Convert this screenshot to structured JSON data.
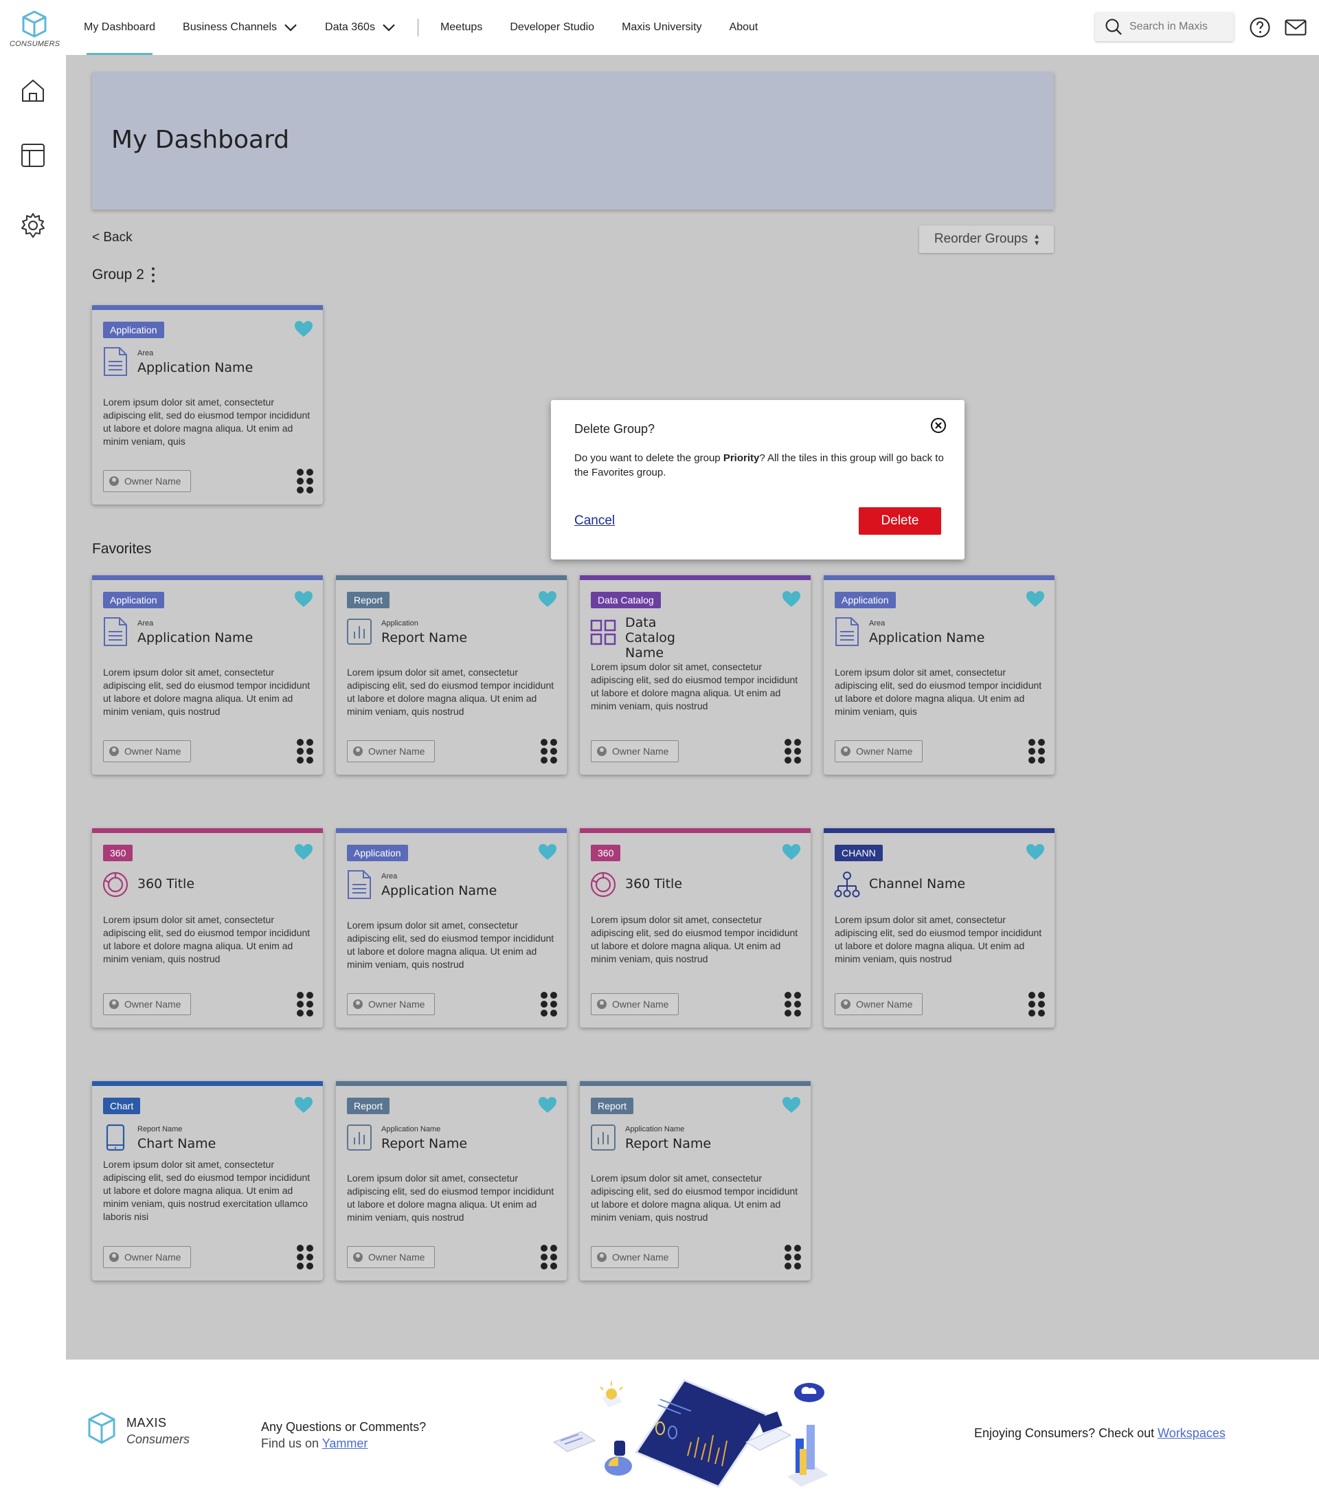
{
  "brand": {
    "logo_text": "CONSUMERS"
  },
  "nav": {
    "items": [
      {
        "label": "My Dashboard",
        "active": true,
        "dropdown": false
      },
      {
        "label": "Business Channels",
        "active": false,
        "dropdown": true
      },
      {
        "label": "Data 360s",
        "active": false,
        "dropdown": true
      },
      {
        "label": "Meetups",
        "active": false,
        "dropdown": false
      },
      {
        "label": "Developer Studio",
        "active": false,
        "dropdown": false
      },
      {
        "label": "Maxis University",
        "active": false,
        "dropdown": false
      },
      {
        "label": "About",
        "active": false,
        "dropdown": false
      }
    ],
    "search_placeholder": "Search in Maxis"
  },
  "banner": {
    "title": "My Dashboard"
  },
  "back_label": "< Back",
  "reorder_label": "Reorder Groups",
  "groups": {
    "group2_title": "Group 2",
    "favorites_title": "Favorites"
  },
  "colors": {
    "application": "#5a6ab8",
    "report": "#5a7590",
    "data_catalog": "#6b3fa0",
    "d360": "#a83b78",
    "channel": "#2a3a88",
    "chart": "#2a5aa8",
    "heart": "#4ab4c8",
    "delete": "#d9121d"
  },
  "cards": [
    {
      "tag": "Application",
      "type": "application",
      "icon": "document-icon",
      "area": "Area",
      "name": "Application Name",
      "desc": "Lorem ipsum dolor sit amet, consectetur adipiscing elit, sed do eiusmod tempor incididunt ut labore et dolore magna aliqua. Ut enim ad minim veniam, quis",
      "owner": "Owner Name"
    },
    {
      "tag": "Application",
      "type": "application",
      "icon": "document-icon",
      "area": "Area",
      "name": "Application Name",
      "desc": "Lorem ipsum dolor sit amet, consectetur adipiscing elit, sed do eiusmod tempor incididunt ut labore et dolore magna aliqua. Ut enim ad minim veniam, quis nostrud",
      "owner": "Owner Name"
    },
    {
      "tag": "Report",
      "type": "report",
      "icon": "report-icon",
      "area": "Application",
      "name": "Report Name",
      "desc": "Lorem ipsum dolor sit amet, consectetur adipiscing elit, sed do eiusmod tempor incididunt ut labore et dolore magna aliqua. Ut enim ad minim veniam, quis nostrud",
      "owner": "Owner Name"
    },
    {
      "tag": "Data Catalog",
      "type": "data_catalog",
      "icon": "grid-icon",
      "area": "",
      "name": "Data Catalog Name",
      "desc": "Lorem ipsum dolor sit amet, consectetur adipiscing elit, sed do eiusmod tempor incididunt ut labore et dolore magna aliqua. Ut enim ad minim veniam, quis nostrud",
      "owner": "Owner Name"
    },
    {
      "tag": "Application",
      "type": "application",
      "icon": "document-icon",
      "area": "Area",
      "name": "Application Name",
      "desc": "Lorem ipsum dolor sit amet, consectetur adipiscing elit, sed do eiusmod tempor incididunt ut labore et dolore magna aliqua. Ut enim ad minim veniam, quis",
      "owner": "Owner Name"
    },
    {
      "tag": "360",
      "type": "d360",
      "icon": "donut-icon",
      "area": "",
      "name": "360 Title",
      "desc": "Lorem ipsum dolor sit amet, consectetur adipiscing elit, sed do eiusmod tempor incididunt ut labore et dolore magna aliqua. Ut enim ad minim veniam, quis nostrud",
      "owner": "Owner Name"
    },
    {
      "tag": "Application",
      "type": "application",
      "icon": "document-icon",
      "area": "Area",
      "name": "Application Name",
      "desc": "Lorem ipsum dolor sit amet, consectetur adipiscing elit, sed do eiusmod tempor incididunt ut labore et dolore magna aliqua. Ut enim ad minim veniam, quis nostrud",
      "owner": "Owner Name"
    },
    {
      "tag": "360",
      "type": "d360",
      "icon": "donut-icon",
      "area": "",
      "name": "360 Title",
      "desc": "Lorem ipsum dolor sit amet, consectetur adipiscing elit, sed do eiusmod tempor incididunt ut labore et dolore magna aliqua. Ut enim ad minim veniam, quis nostrud",
      "owner": "Owner Name"
    },
    {
      "tag": "CHANN",
      "type": "channel",
      "icon": "hierarchy-icon",
      "area": "",
      "name": "Channel Name",
      "desc": "Lorem ipsum dolor sit amet, consectetur adipiscing elit, sed do eiusmod tempor incididunt ut labore et dolore magna aliqua. Ut enim ad minim veniam, quis nostrud",
      "owner": "Owner Name"
    },
    {
      "tag": "Chart",
      "type": "chart",
      "icon": "tablet-icon",
      "area": "Report Name",
      "name": "Chart Name",
      "desc": "Lorem ipsum dolor sit amet, consectetur adipiscing elit, sed do eiusmod tempor incididunt ut labore et dolore magna aliqua. Ut enim ad minim veniam, quis nostrud exercitation ullamco laboris nisi",
      "owner": "Owner Name"
    },
    {
      "tag": "Report",
      "type": "report",
      "icon": "report-icon",
      "area": "Application Name",
      "name": "Report Name",
      "desc": "Lorem ipsum dolor sit amet, consectetur adipiscing elit, sed do eiusmod tempor incididunt ut labore et dolore magna aliqua. Ut enim ad minim veniam, quis nostrud",
      "owner": "Owner Name"
    },
    {
      "tag": "Report",
      "type": "report",
      "icon": "report-icon",
      "area": "Application Name",
      "name": "Report Name",
      "desc": "Lorem ipsum dolor sit amet, consectetur adipiscing elit, sed do eiusmod tempor incididunt ut labore et dolore magna aliqua. Ut enim ad minim veniam, quis nostrud",
      "owner": "Owner Name"
    }
  ],
  "modal": {
    "title": "Delete Group?",
    "msg_before": "Do you want to delete the group ",
    "msg_group": "Priority",
    "msg_after": "? All the tiles in this group will go back to the Favorites group.",
    "cancel_label": "Cancel",
    "delete_label": "Delete"
  },
  "footer": {
    "brand": "MAXIS",
    "brand_sub": "Consumers",
    "question": "Any Questions or Comments?",
    "find_prefix": "Find us on ",
    "find_link": "Yammer",
    "enjoy_prefix": "Enjoying Consumers? Check out ",
    "enjoy_link": "Workspaces"
  }
}
